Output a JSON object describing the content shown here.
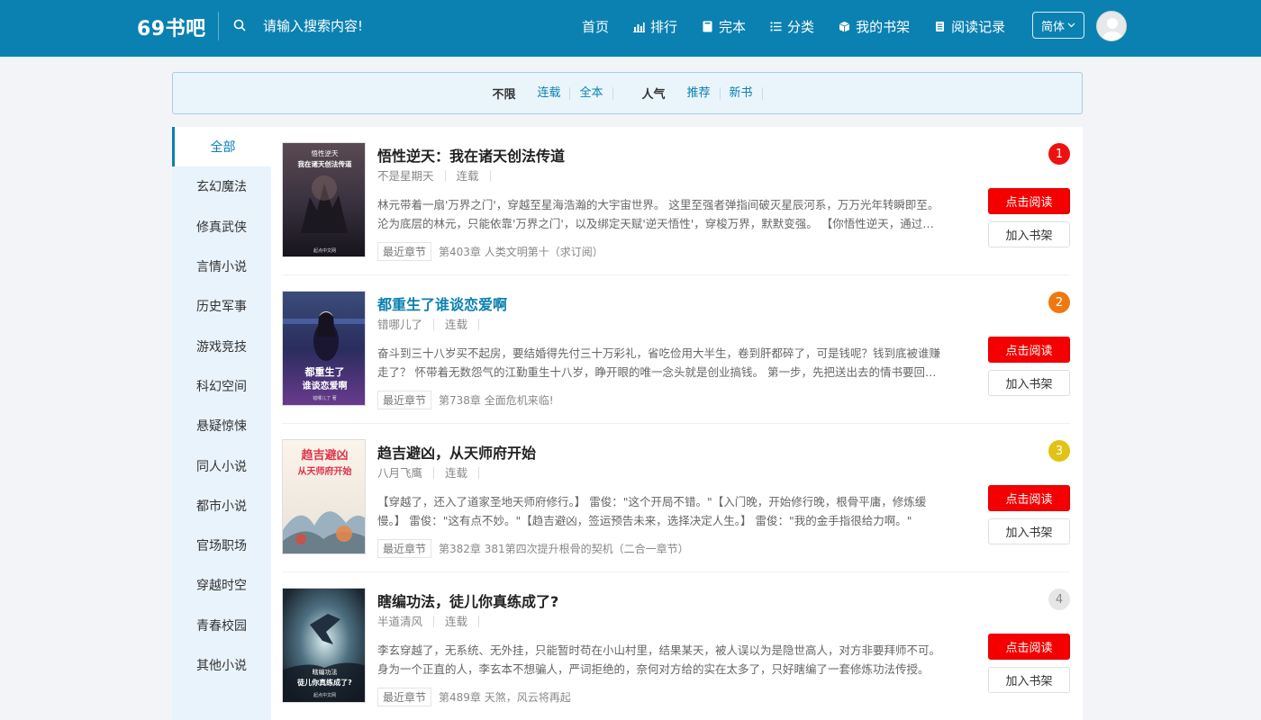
{
  "header": {
    "logo": "69书吧",
    "search_placeholder": "请输入搜索内容!",
    "nav": [
      {
        "label": "首页",
        "icon": "none"
      },
      {
        "label": "排行",
        "icon": "bar-chart-icon"
      },
      {
        "label": "完本",
        "icon": "book-icon"
      },
      {
        "label": "分类",
        "icon": "list-icon"
      },
      {
        "label": "我的书架",
        "icon": "box-icon"
      },
      {
        "label": "阅读记录",
        "icon": "document-icon"
      }
    ],
    "lang": "简体"
  },
  "filters": {
    "status_head": "不限",
    "status_opts": [
      "连载",
      "全本"
    ],
    "sort_head": "人气",
    "sort_opts": [
      "推荐",
      "新书"
    ]
  },
  "sidebar": {
    "items": [
      "全部",
      "玄幻魔法",
      "修真武侠",
      "言情小说",
      "历史军事",
      "游戏竞技",
      "科幻空间",
      "悬疑惊悚",
      "同人小说",
      "都市小说",
      "官场职场",
      "穿越时空",
      "青春校园",
      "其他小说"
    ],
    "active_index": 0
  },
  "books": [
    {
      "rank": "1",
      "rank_color": "#ee1111",
      "title": "悟性逆天：我在诸天创法传道",
      "author": "不是星期天",
      "status": "连载",
      "desc": "林元带着一扇'万界之门'，穿越至星海浩瀚的大宇宙世界。 这里至强者弹指间破灭星辰河系，万万光年转瞬即至。 沦为底层的林元，只能依靠'万界之门'，以及绑定天赋'逆天悟性'，穿梭万界，默默变强。 【你悟性逆天，通过观摩千年来死在城外的战士遗物，自创无上武道功法】",
      "latest_tag": "最近章节",
      "latest": "第403章 人类文明第十（求订阅）",
      "cover_text_1": "悟性逆天",
      "cover_text_2": "我在诸天创法传道",
      "cover_footer": "起点中文网"
    },
    {
      "rank": "2",
      "rank_color": "#f07810",
      "title": "都重生了谁谈恋爱啊",
      "author": "错哪儿了",
      "status": "连载",
      "desc": "奋斗到三十八岁买不起房，要结婚得先付三十万彩礼，省吃俭用大半生，卷到肝都碎了，可是钱呢？钱到底被谁赚走了？ 怀带着无数怨气的江勤重生十八岁，睁开眼的唯一念头就是创业搞钱。 第一步，先把送出去的情书要回来。",
      "latest_tag": "最近章节",
      "latest": "第738章 全面危机来临!",
      "cover_text_1": "都重生了",
      "cover_text_2": "谁谈恋爱啊",
      "cover_footer": "错哪儿了 著"
    },
    {
      "rank": "3",
      "rank_color": "#e0c315",
      "title": "趋吉避凶，从天师府开始",
      "author": "八月飞鹰",
      "status": "连载",
      "desc": "【穿越了，还入了道家圣地天师府修行。】 雷俊：\"这个开局不错。\"【入门晚，开始修行晚，根骨平庸，修炼缓慢。】 雷俊：\"这有点不妙。\"【趋吉避凶，签运预告未来，选择决定人生。】 雷俊：\"我的金手指很给力啊。\"",
      "latest_tag": "最近章节",
      "latest": "第382章 381第四次提升根骨的契机（二合一章节）",
      "cover_text_1": "趋吉避凶",
      "cover_text_2": "从天师府开始",
      "cover_footer": ""
    },
    {
      "rank": "4",
      "rank_color": "#e6e6e6",
      "title": "瞎编功法，徒儿你真练成了?",
      "author": "半道清风",
      "status": "连载",
      "desc": "李玄穿越了，无系统、无外挂，只能暂时苟在小山村里，结果某天，被人误以为是隐世高人，对方非要拜师不可。 身为一个正直的人，李玄本不想骗人，严词拒绝的，奈何对方给的实在太多了，只好瞎编了一套修炼功法传授。",
      "latest_tag": "最近章节",
      "latest": "第489章 天煞，风云将再起",
      "cover_text_1": "瞎编功法",
      "cover_text_2": "徒儿你真练成了?",
      "cover_footer": "起点中文网"
    }
  ],
  "buttons": {
    "read": "点击阅读",
    "shelf": "加入书架"
  }
}
